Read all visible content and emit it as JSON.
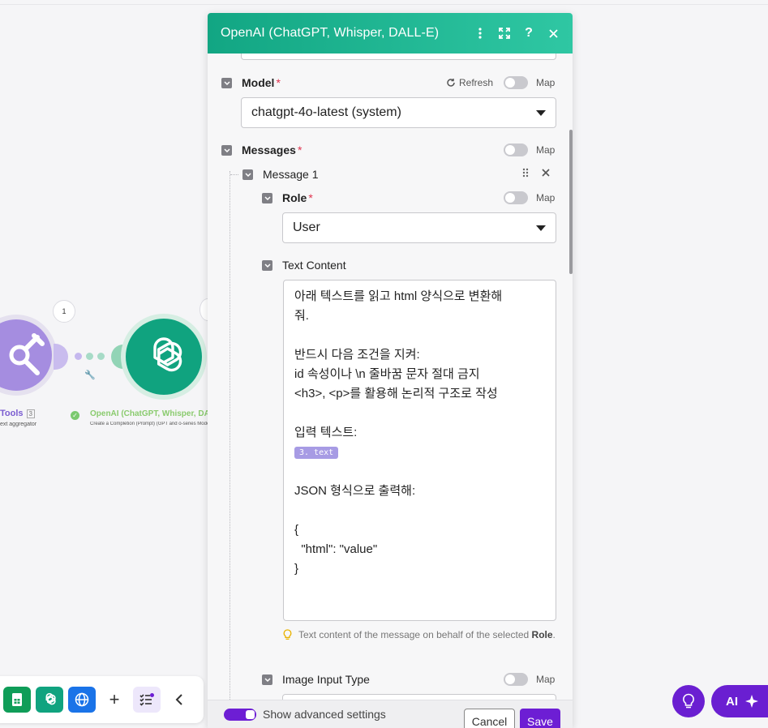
{
  "canvas": {
    "tools_node": {
      "label": "Tools",
      "count": "3",
      "sublabel": "ext aggregator",
      "badge": "1"
    },
    "openai_node": {
      "label": "OpenAI (ChatGPT, Whisper, DALL-E)",
      "sublabel": "Create a Completion (Prompt) (GPT and o-series Models)",
      "badge": ""
    },
    "fab_ai_label": "AI"
  },
  "panel": {
    "title": "OpenAI (ChatGPT, Whisper, DALL-E)",
    "model": {
      "label": "Model",
      "required": "*",
      "refresh_label": "Refresh",
      "map_label": "Map",
      "value": "chatgpt-4o-latest (system)"
    },
    "messages": {
      "label": "Messages",
      "required": "*",
      "map_label": "Map",
      "item_label": "Message 1",
      "role": {
        "label": "Role",
        "required": "*",
        "map_label": "Map",
        "value": "User"
      },
      "text_content": {
        "label": "Text Content",
        "lines": [
          "아래 텍스트를 읽고 html 양식으로 변환해",
          "줘.",
          "",
          "반드시 다음 조건을 지켜:",
          "id 속성이나 \\n 줄바꿈 문자 절대 금지",
          "<h3>, <p>를 활용해 논리적 구조로 작성",
          "",
          "입력 텍스트:",
          "",
          "",
          "JSON 형식으로 출력해:",
          "",
          "{",
          "  \"html\": \"value\"",
          "}"
        ],
        "variable_pill": "3. text",
        "hint_text": "Text content of the message on behalf of the selected",
        "hint_bold": "Role",
        "hint_end": "."
      },
      "image_input_type": {
        "label": "Image Input Type",
        "map_label": "Map"
      }
    },
    "footer": {
      "advanced_label": "Show advanced settings",
      "cancel_label": "Cancel",
      "save_label": "Save"
    }
  },
  "colors": {
    "header_start": "#12a683",
    "header_end": "#2fc7a3",
    "accent_purple": "#6d1ed4",
    "required_red": "#e0334f",
    "openai_green": "#10a37f"
  }
}
